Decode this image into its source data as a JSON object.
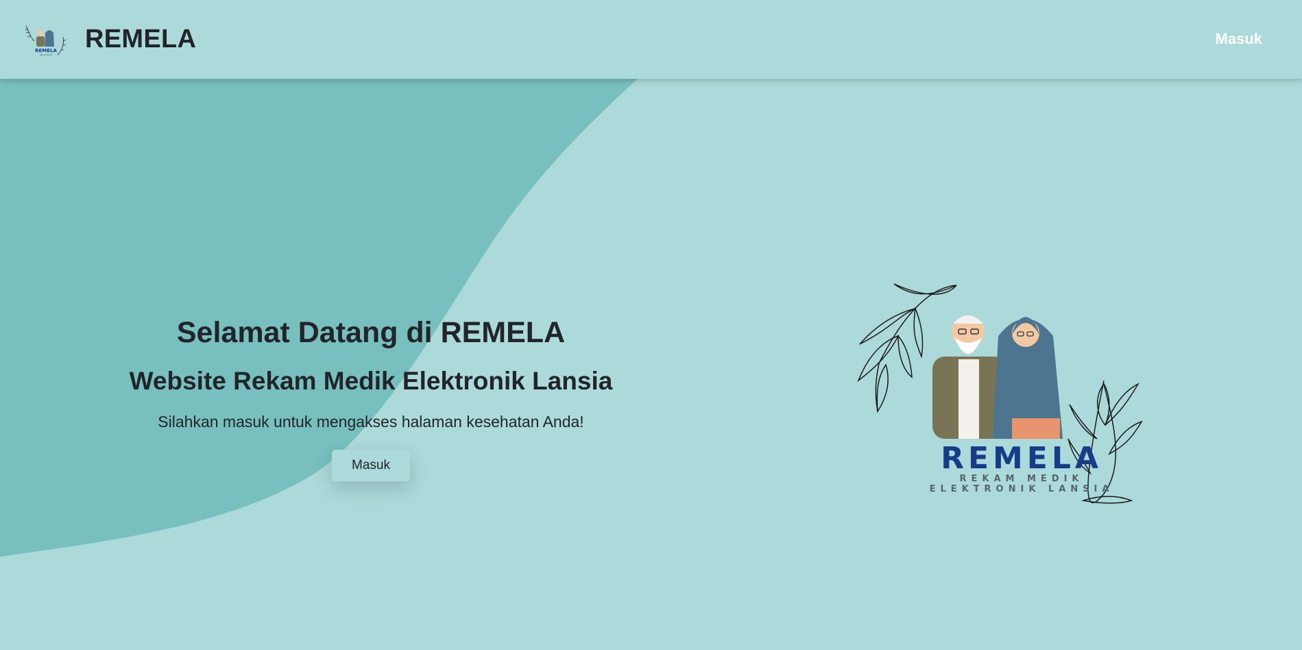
{
  "nav": {
    "brand": "REMELA",
    "login_label": "Masuk"
  },
  "hero": {
    "title": "Selamat Datang di REMELA",
    "subtitle": "Website Rekam Medik Elektronik Lansia",
    "description": "Silahkan masuk untuk mengakses halaman kesehatan Anda!",
    "button_label": "Masuk"
  },
  "logo": {
    "title": "REMELA",
    "line1": "REKAM MEDIK",
    "line2": "ELEKTRONIK LANSIA"
  },
  "colors": {
    "background": "#acd9d9",
    "blob": "#78bfbf",
    "nav_link": "#ffffff",
    "logo_title": "#173d8a",
    "text": "#212529"
  }
}
